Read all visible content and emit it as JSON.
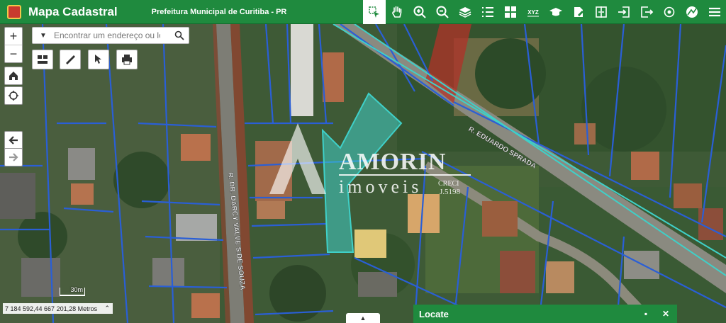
{
  "header": {
    "app_title": "Mapa Cadastral",
    "organization": "Prefeitura Municipal de Curitiba - PR",
    "tools": [
      {
        "name": "identify-tool",
        "icon": "identify-cursor-icon",
        "active": true
      },
      {
        "name": "pan-tool",
        "icon": "hand-icon",
        "active": false
      },
      {
        "name": "zoom-in-tool",
        "icon": "zoom-in-icon",
        "active": false
      },
      {
        "name": "zoom-out-tool",
        "icon": "zoom-out-icon",
        "active": false
      },
      {
        "name": "layers-tool",
        "icon": "layers-icon",
        "active": false
      },
      {
        "name": "legend-tool",
        "icon": "list-icon",
        "active": false
      },
      {
        "name": "basemap-tool",
        "icon": "grid-icon",
        "active": false
      },
      {
        "name": "coordinates-tool",
        "icon": "xyz-icon",
        "active": false
      },
      {
        "name": "education-tool",
        "icon": "graduation-cap-icon",
        "active": false
      },
      {
        "name": "edit-tool",
        "icon": "edit-icon",
        "active": false
      },
      {
        "name": "compare-tool",
        "icon": "compare-icon",
        "active": false
      },
      {
        "name": "login-tool",
        "icon": "sign-in-icon",
        "active": false
      },
      {
        "name": "logout-tool",
        "icon": "sign-out-icon",
        "active": false
      },
      {
        "name": "gps-tool",
        "icon": "target-icon",
        "active": false
      },
      {
        "name": "basemap-gallery-tool",
        "icon": "map-icon",
        "active": false
      },
      {
        "name": "menu-tool",
        "icon": "hamburger-menu-icon",
        "active": false
      }
    ]
  },
  "search": {
    "placeholder": "Encontrar um endereço ou lo"
  },
  "zoom": {
    "in_label": "+",
    "out_label": "−"
  },
  "map": {
    "street_1": "R. DR. DARCY VALVE S.DE SOUZA",
    "street_2": "R. EDUARDO SPRADA",
    "scale_label": "30m",
    "coordinates": "7 184 592,44 667 201,28 Metros"
  },
  "watermark": {
    "brand": "AMORIN",
    "subtitle": "imoveis",
    "creci": "CRECI",
    "creci_number": "J.5198"
  },
  "locate_panel": {
    "title": "Locate",
    "maximize_icon": "▪",
    "close_icon": "✕"
  },
  "colors": {
    "header": "#1f8a3e",
    "parcel_lines": "#2a5fd6",
    "highlight_parcel": "#3fd0c8",
    "restricted_area": "#c0392b"
  }
}
